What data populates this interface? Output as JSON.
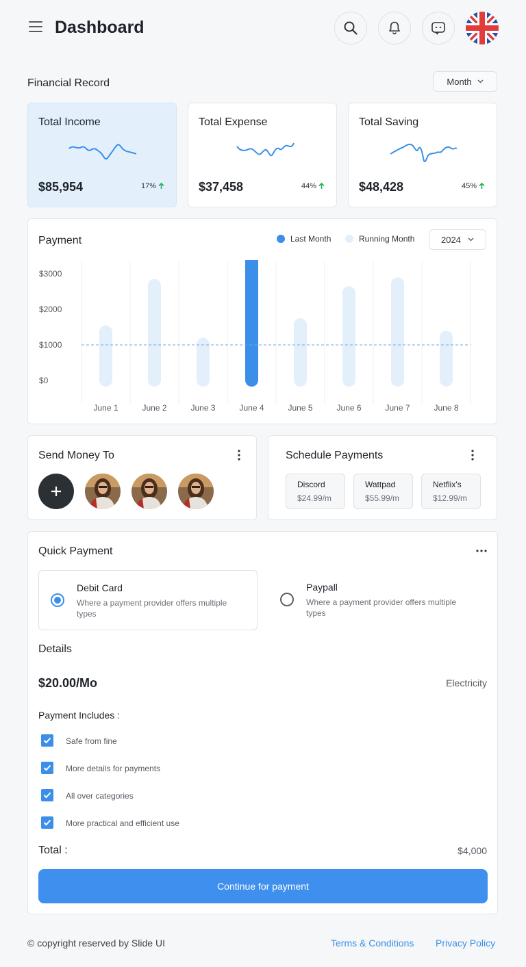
{
  "header": {
    "title": "Dashboard"
  },
  "financial": {
    "label": "Financial Record",
    "period": "Month",
    "cards": [
      {
        "title": "Total Income",
        "value": "$85,954",
        "pct": "17%"
      },
      {
        "title": "Total Expense",
        "value": "$37,458",
        "pct": "44%"
      },
      {
        "title": "Total Saving",
        "value": "$48,428",
        "pct": "45%"
      }
    ]
  },
  "colors": {
    "accent": "#3b8fe8",
    "bar_light": "#e3f0fc",
    "up_arrow": "#22b25a"
  },
  "payment": {
    "title": "Payment",
    "legend_last": "Last Month",
    "legend_running": "Running Month",
    "year": "2024"
  },
  "chart_data": {
    "type": "bar",
    "title": "Payment",
    "categories": [
      "June 1",
      "June 2",
      "June 3",
      "June 4",
      "June 5",
      "June 6",
      "June 7",
      "June 8"
    ],
    "series": [
      {
        "name": "Running Month",
        "values": [
          1550,
          2850,
          1200,
          3600,
          1750,
          2650,
          2900,
          1400
        ]
      }
    ],
    "highlight_index": 3,
    "highlight_series": "Last Month",
    "reference_line": 1000,
    "yticks": [
      "$3000",
      "$2000",
      "$1000",
      "$0"
    ],
    "ylim": [
      0,
      3600
    ],
    "grid": "vertical",
    "legend": "top-right"
  },
  "send_money": {
    "title": "Send Money To"
  },
  "schedule": {
    "title": "Schedule Payments",
    "items": [
      {
        "name": "Discord",
        "price": "$24.99/m"
      },
      {
        "name": "Wattpad",
        "price": "$55.99/m"
      },
      {
        "name": "Netflix's",
        "price": "$12.99/m"
      }
    ]
  },
  "quick": {
    "title": "Quick Payment",
    "options": [
      {
        "name": "Debit Card",
        "desc": "Where a payment provider offers multiple types"
      },
      {
        "name": "Paypall",
        "desc": "Where a payment provider offers multiple types"
      }
    ],
    "details_label": "Details",
    "amount": "$20.00/Mo",
    "category": "Electricity",
    "includes_label": "Payment Includes :",
    "includes": [
      "Safe from fine",
      "More details for payments",
      "All over categories",
      "More practical and efficient use"
    ],
    "total_label": "Total :",
    "total_value": "$4,000",
    "continue_label": "Continue for payment"
  },
  "footer": {
    "copyright": "© copyright reserved by Slide UI",
    "terms": "Terms & Conditions",
    "privacy": "Privacy Policy"
  }
}
